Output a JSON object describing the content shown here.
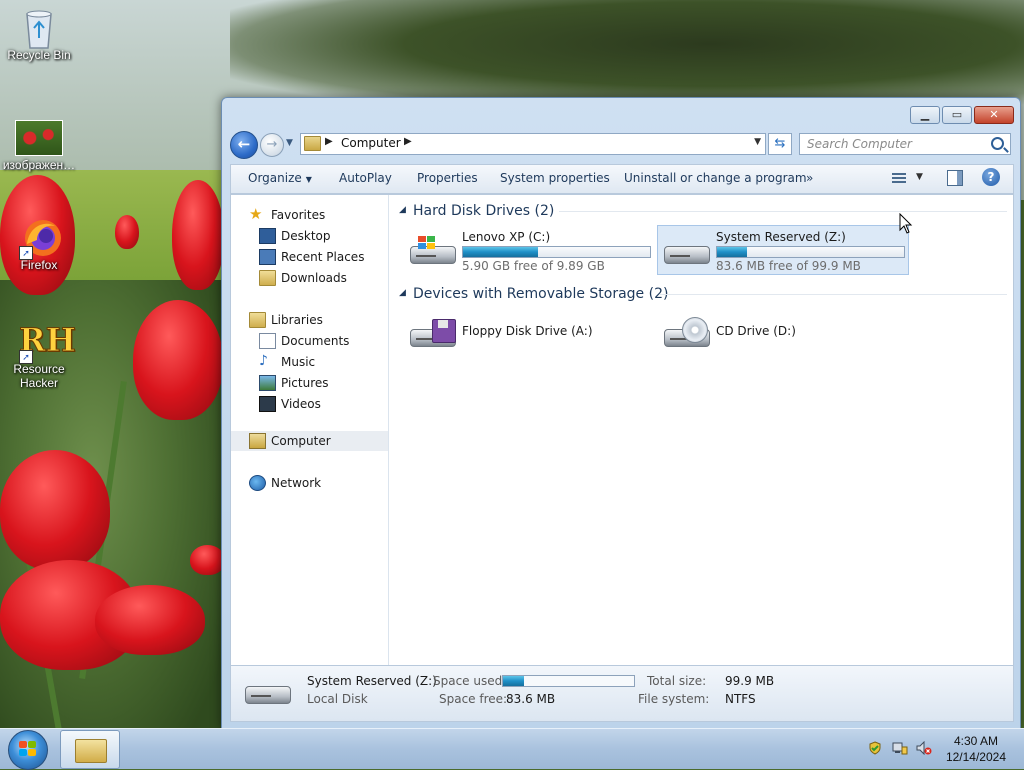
{
  "desktop": {
    "icons": [
      {
        "label": "Recycle Bin",
        "icon": "recycle-bin-icon"
      },
      {
        "label": "изображен…",
        "icon": "image-thumbnail-icon"
      },
      {
        "label": "Firefox",
        "icon": "firefox-icon"
      },
      {
        "label": "Resource Hacker",
        "icon": "resource-hacker-icon",
        "glyph_text": "RH"
      }
    ]
  },
  "window": {
    "address": {
      "path": "Computer"
    },
    "search": {
      "placeholder": "Search Computer"
    },
    "toolbar": {
      "organize": "Organize",
      "autoplay": "AutoPlay",
      "properties": "Properties",
      "system_properties": "System properties",
      "uninstall": "Uninstall or change a program",
      "more": "»"
    },
    "nav": {
      "favorites": "Favorites",
      "desktop": "Desktop",
      "recent_places": "Recent Places",
      "downloads": "Downloads",
      "libraries": "Libraries",
      "documents": "Documents",
      "music": "Music",
      "pictures": "Pictures",
      "videos": "Videos",
      "computer": "Computer",
      "network": "Network"
    },
    "groups": {
      "hdd": {
        "title": "Hard Disk Drives (2)",
        "drives": [
          {
            "name": "Lenovo XP (C:)",
            "free": "5.90 GB free of 9.89 GB",
            "used_fraction": 0.4
          },
          {
            "name": "System Reserved (Z:)",
            "free": "83.6 MB free of 99.9 MB",
            "used_fraction": 0.16
          }
        ]
      },
      "removable": {
        "title": "Devices with Removable Storage (2)",
        "drives": [
          {
            "name": "Floppy Disk Drive (A:)"
          },
          {
            "name": "CD Drive (D:)"
          }
        ]
      }
    },
    "details": {
      "name": "System Reserved (Z:)",
      "type": "Local Disk",
      "space_used_label": "Space used:",
      "space_used_fraction": 0.16,
      "space_free_label": "Space free:",
      "space_free": "83.6 MB",
      "total_size_label": "Total size:",
      "total_size": "99.9 MB",
      "file_system_label": "File system:",
      "file_system": "NTFS"
    }
  },
  "taskbar": {
    "time": "4:30 AM",
    "date": "12/14/2024"
  },
  "colors": {
    "accent": "#1f8fc7",
    "nav_text": "#1e395b",
    "selection": "#dce9f7"
  }
}
